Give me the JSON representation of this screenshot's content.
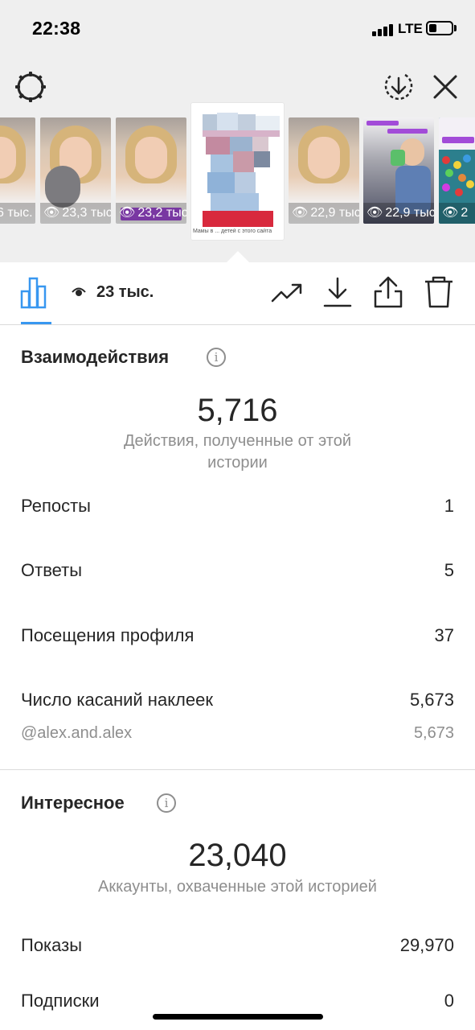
{
  "status_bar": {
    "time": "22:38",
    "network": "LTE"
  },
  "story_strip": {
    "thumbnails": [
      {
        "views": "6 тыс."
      },
      {
        "views": "23,3 тыс."
      },
      {
        "views": "23,2 тыс."
      },
      {
        "views": "22,9 тыс."
      },
      {
        "views": "22,9 тыс."
      },
      {
        "views": "2"
      }
    ],
    "selected_caption": "Мамы в ... детей с этого сайта"
  },
  "action_bar": {
    "views": "23 тыс."
  },
  "interactions": {
    "title": "Взаимодействия",
    "total": "5,716",
    "caption": "Действия, полученные от этой истории",
    "rows": [
      {
        "label": "Репосты",
        "value": "1"
      },
      {
        "label": "Ответы",
        "value": "5"
      },
      {
        "label": "Посещения профиля",
        "value": "37"
      },
      {
        "label": "Число касаний наклеек",
        "value": "5,673"
      }
    ],
    "sub_row": {
      "label": "@alex.and.alex",
      "value": "5,673"
    }
  },
  "discovery": {
    "title": "Интересное",
    "total": "23,040",
    "caption": "Аккаунты, охваченные этой историей",
    "rows": [
      {
        "label": "Показы",
        "value": "29,970"
      },
      {
        "label": "Подписки",
        "value": "0"
      }
    ]
  }
}
